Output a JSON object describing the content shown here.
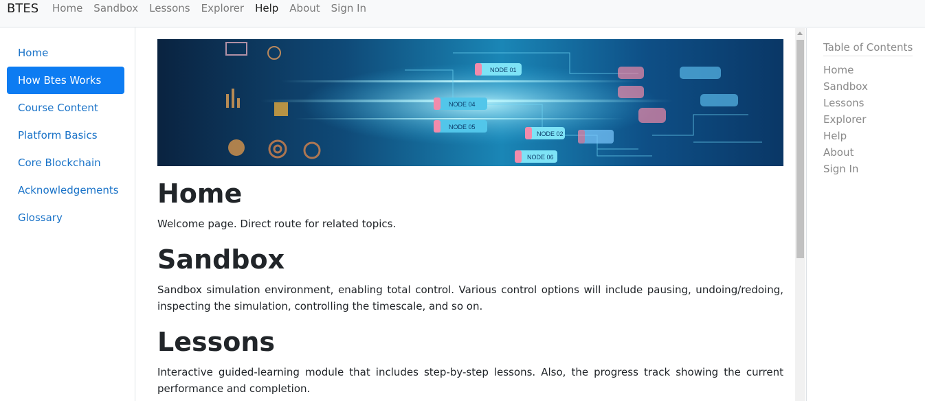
{
  "navbar": {
    "brand": "BTES",
    "links": [
      "Home",
      "Sandbox",
      "Lessons",
      "Explorer",
      "Help",
      "About",
      "Sign In"
    ],
    "active": "Help"
  },
  "sidebar": {
    "items": [
      "Home",
      "How Btes Works",
      "Course Content",
      "Platform Basics",
      "Core Blockchain",
      "Acknowledgements",
      "Glossary"
    ],
    "active": "How Btes Works"
  },
  "hero": {
    "nodes": [
      "NODE 01",
      "NODE 04",
      "NODE 05",
      "NODE 02",
      "NODE 06"
    ]
  },
  "sections": [
    {
      "title": "Home",
      "text": "Welcome page. Direct route for related topics."
    },
    {
      "title": "Sandbox",
      "text": "Sandbox simulation environment, enabling total control. Various control options will include pausing, undoing/redoing, inspecting the simulation, controlling the timescale, and so on."
    },
    {
      "title": "Lessons",
      "text": "Interactive guided-learning module that includes step-by-step lessons. Also, the progress track showing the current performance and completion."
    }
  ],
  "toc": {
    "title": "Table of Contents",
    "items": [
      "Home",
      "Sandbox",
      "Lessons",
      "Explorer",
      "Help",
      "About",
      "Sign In"
    ]
  },
  "colors": {
    "accent": "#0d7cf2",
    "link": "#1a73c8",
    "muted": "#8a8a8a"
  }
}
